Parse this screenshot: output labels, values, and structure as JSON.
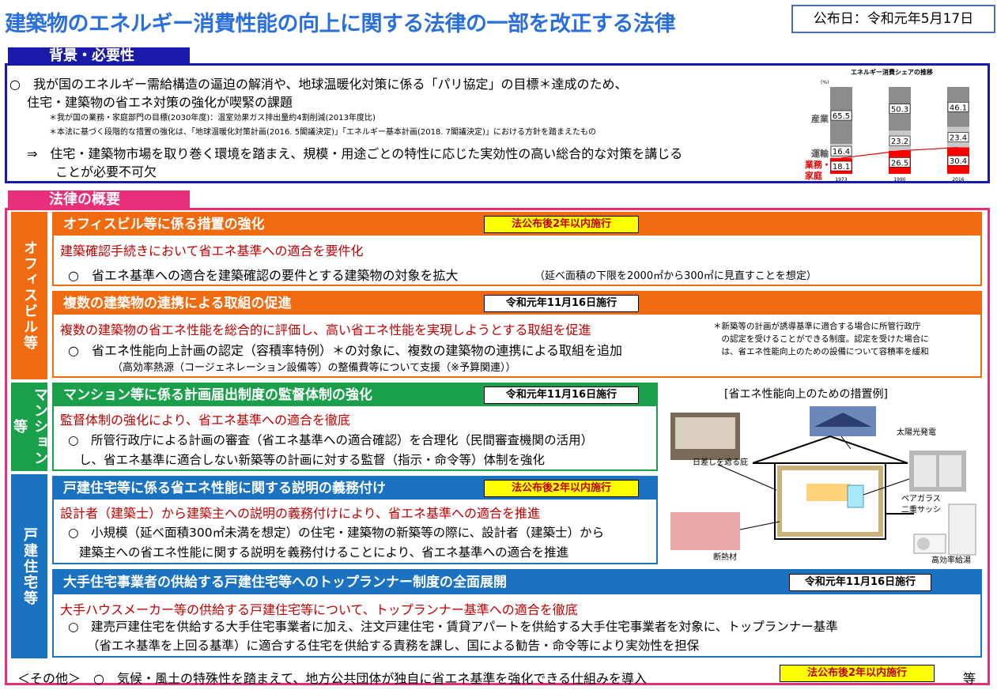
{
  "header": {
    "title": "建築物のエネルギー消費性能の向上に関する法律の一部を改正する法律",
    "pub_date": "公布日：令和元年5月17日"
  },
  "background": {
    "tab": "背景・必要性",
    "line1": "○　我が国のエネルギー需給構造の逼迫の解消や、地球温暖化対策に係る「パリ協定」の目標＊達成のため、",
    "line2": "住宅・建築物の省エネ対策の強化が喫緊の課題",
    "note1": "＊我が国の業務・家庭部門の目標(2030年度)：温室効果ガス排出量約4割削減(2013年度比)",
    "note2": "＊本法に基づく段階的な措置の強化は、「地球温暖化対策計画(2016. 5閣議決定)」「エネルギー基本計画(2018. 7閣議決定)」における方針を踏まえたもの",
    "arrow_line1": "⇒　住宅・建築物市場を取り巻く環境を踏まえ、規模・用途ごとの特性に応じた実効性の高い総合的な対策を講じる",
    "arrow_line2": "ことが必要不可欠"
  },
  "chart_data": {
    "type": "bar",
    "title": "エネルギー消費シェアの推移",
    "unit": "(%)",
    "categories": [
      "1973",
      "1990",
      "2016"
    ],
    "series": [
      {
        "name": "産業",
        "values": [
          65.5,
          50.3,
          46.1
        ],
        "color": "#8c8c8c"
      },
      {
        "name": "運輸",
        "values": [
          16.4,
          23.2,
          23.4
        ],
        "color": "#c8c8c8"
      },
      {
        "name": "業務・家庭",
        "values": [
          18.1,
          26.5,
          30.4
        ],
        "color": "#ff0000"
      }
    ],
    "labels": [
      "産業",
      "運輸",
      "業務・",
      "家庭"
    ]
  },
  "law": {
    "tab": "法律の概要",
    "side_office": "オフィスビル等",
    "side_mansion": "マンション等",
    "side_house": "戸建住宅等",
    "s1": {
      "title": "オフィスビル等に係る措置の強化",
      "badge": "法公布後2年以内施行",
      "lead": "建築確認手続きにおいて省エネ基準への適合を要件化",
      "item": "○　省エネ基準への適合を建築確認の要件とする建築物の対象を拡大",
      "item_note": "（延べ面積の下限を2000㎡から300㎡に見直すことを想定）"
    },
    "s2": {
      "title": "複数の建築物の連携による取組の促進",
      "badge": "令和元年11月16日施行",
      "lead": "複数の建築物の省エネ性能を総合的に評価し、高い省エネ性能を実現しようとする取組を促進",
      "item": "○　省エネ性能向上計画の認定（容積率特例）＊の対象に、複数の建築物の連携による取組を追加",
      "sub": "（高効率熱源（コージェネレーション設備等）の整備費等について支援（※予算関連））",
      "note1": "＊新築等の計画が誘導基準に適合する場合に所管行政庁",
      "note2": "　の認定を受けることができる制度。認定を受けた場合に",
      "note3": "　は、省エネ性能向上のための設備について容積率を緩和"
    },
    "s3": {
      "title": "マンション等に係る計画届出制度の監督体制の強化",
      "badge": "令和元年11月16日施行",
      "lead": "監督体制の強化により、省エネ基準への適合を徹底",
      "item1": "○　所管行政庁による計画の審査（省エネ基準への適合確認）を合理化（民間審査機関の活用）",
      "item2": "し、省エネ基準に適合しない新築等の計画に対する監督（指示・命令等）体制を強化"
    },
    "s4": {
      "title": "戸建住宅等に係る省エネ性能に関する説明の義務付け",
      "badge": "法公布後2年以内施行",
      "lead": "設計者（建築士）から建築主への説明の義務付けにより、省エネ基準への適合を推進",
      "item1": "○　小規模（延べ面積300㎡未満を想定）の住宅・建築物の新築等の際に、設計者（建築士）から",
      "item2": "建築主への省エネ性能に関する説明を義務付けることにより、省エネ基準への適合を推進"
    },
    "s5": {
      "title": "大手住宅事業者の供給する戸建住宅等へのトップランナー制度の全面展開",
      "badge": "令和元年11月16日施行",
      "lead": "大手ハウスメーカー等の供給する戸建住宅等について、トップランナー基準への適合を徹底",
      "item1": "○　建売戸建住宅を供給する大手住宅事業者に加え、注文戸建住宅・賃貸アパートを供給する大手住宅事業者を対象に、トップランナー基準",
      "item2": "（省エネ基準を上回る基準）に適合する住宅を供給する責務を課し、国による勧告・命令等により実効性を担保"
    },
    "illustration": {
      "title": "[省エネ性能向上のための措置例]",
      "solar": "太陽光発電",
      "shade": "日差しを遮る庇",
      "glass1": "ペアガラス",
      "glass2": "二重サッシ",
      "insulation": "断熱材",
      "heater": "高効率給湯"
    },
    "other": {
      "text": "＜その他＞　○　気候・風土の特殊性を踏まえて、地方公共団体が独自に省エネ基準を強化できる仕組みを導入",
      "badge": "法公布後2年以内施行",
      "etc": "等"
    }
  },
  "colors": {
    "blue_title": "#2a6fdc",
    "navy": "#1a1aa8",
    "pink": "#e8307a",
    "orange": "#f06a10",
    "green": "#1aa04a",
    "blue": "#1b72c0",
    "red_text": "#c00000"
  }
}
